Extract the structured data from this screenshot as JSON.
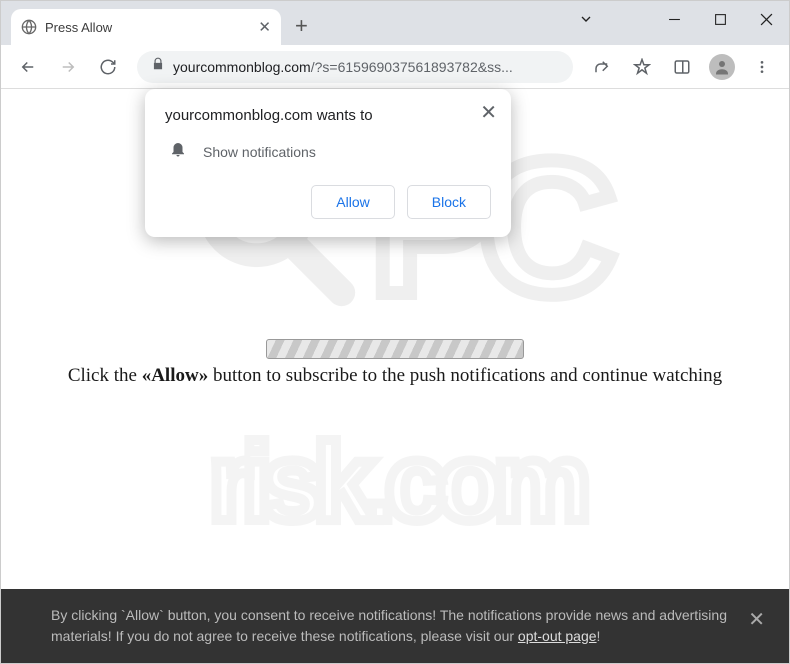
{
  "tab": {
    "title": "Press Allow"
  },
  "url": {
    "domain": "yourcommonblog.com",
    "path": "/?s=615969037561893782&ss..."
  },
  "permission": {
    "title": "yourcommonblog.com wants to",
    "label": "Show notifications",
    "allow": "Allow",
    "block": "Block"
  },
  "page": {
    "msg_pre": "Click the ",
    "msg_bold": "«Allow»",
    "msg_post": " button to subscribe to the push notifications and continue watching"
  },
  "cookie": {
    "text_1": "By clicking `Allow` button, you consent to receive notifications! The notifications provide news and advertising materials! If you do not agree to receive these notifications, please visit our ",
    "link": "opt-out page",
    "text_2": "!"
  }
}
